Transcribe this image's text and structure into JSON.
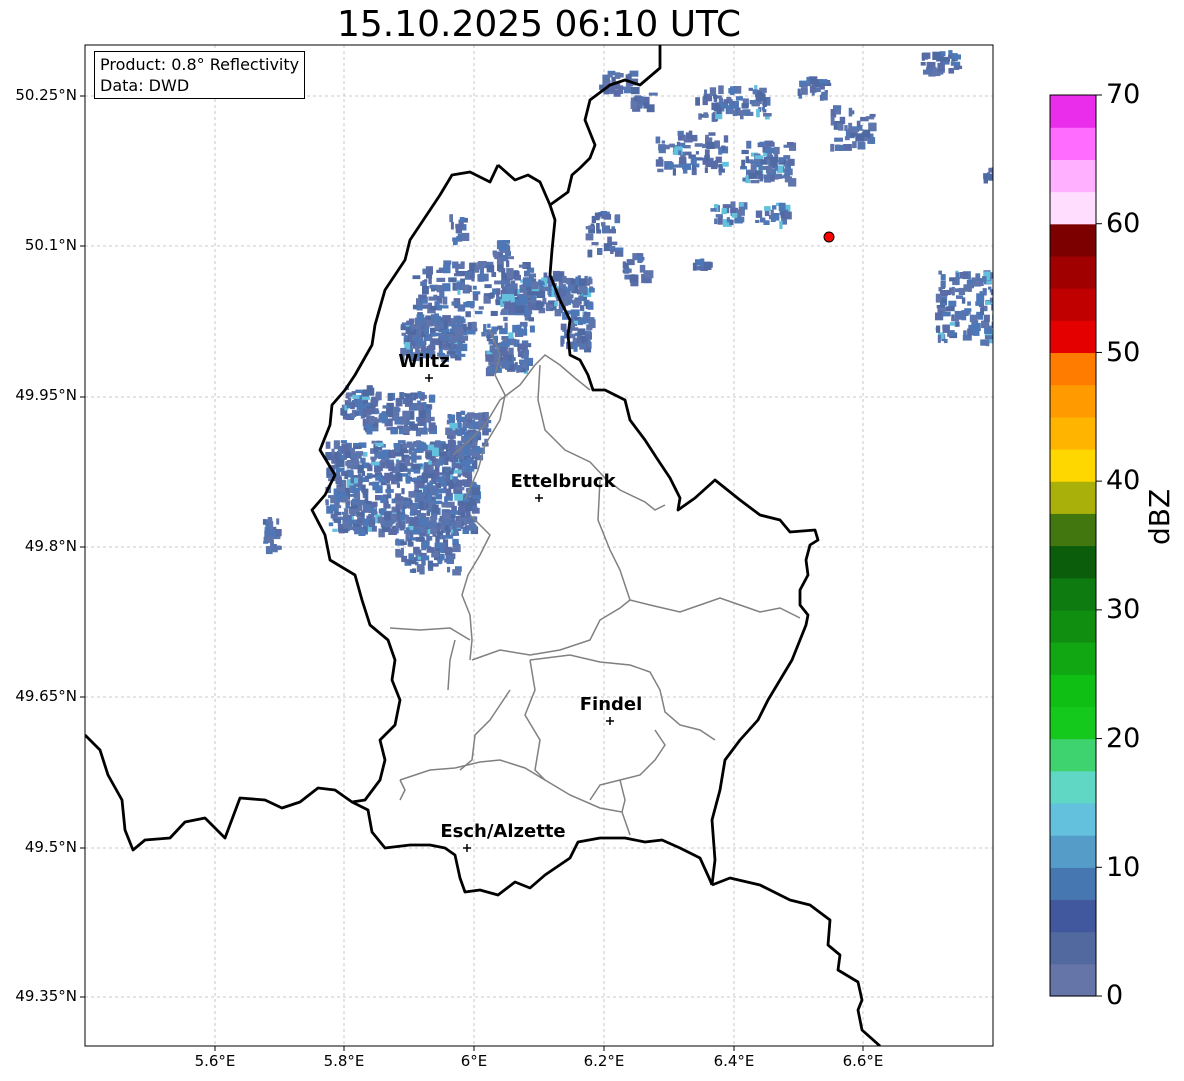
{
  "title": "15.10.2025 06:10 UTC",
  "info": {
    "product": "Product: 0.8° Reflectivity",
    "data": "Data: DWD"
  },
  "axes": {
    "lat_ticks": [
      "50.25°N",
      "50.1°N",
      "49.95°N",
      "49.8°N",
      "49.65°N",
      "49.5°N",
      "49.35°N"
    ],
    "lon_ticks": [
      "5.6°E",
      "5.8°E",
      "6°E",
      "6.2°E",
      "6.4°E",
      "6.6°E"
    ]
  },
  "cities": [
    {
      "name": "Wiltz"
    },
    {
      "name": "Ettelbruck"
    },
    {
      "name": "Findel"
    },
    {
      "name": "Esch/Alzette"
    }
  ],
  "radar_marker_color": "#ff0000",
  "colorbar": {
    "label": "dBZ",
    "ticks": [
      "0",
      "10",
      "20",
      "30",
      "40",
      "50",
      "60",
      "70"
    ],
    "colors": [
      "#6675a8",
      "#52699f",
      "#42589e",
      "#4677b0",
      "#569cc8",
      "#63c1dd",
      "#5fd7c4",
      "#3fd36f",
      "#14c81c",
      "#10bf14",
      "#10a712",
      "#0f8e10",
      "#0d7b10",
      "#0b5d0c",
      "#427710",
      "#a9b00a",
      "#ffd700",
      "#ffb400",
      "#ff9a00",
      "#ff7c00",
      "#e50000",
      "#c00000",
      "#a00000",
      "#7c0000",
      "#ffddff",
      "#ffb0ff",
      "#ff6cff",
      "#ea2dea"
    ]
  }
}
